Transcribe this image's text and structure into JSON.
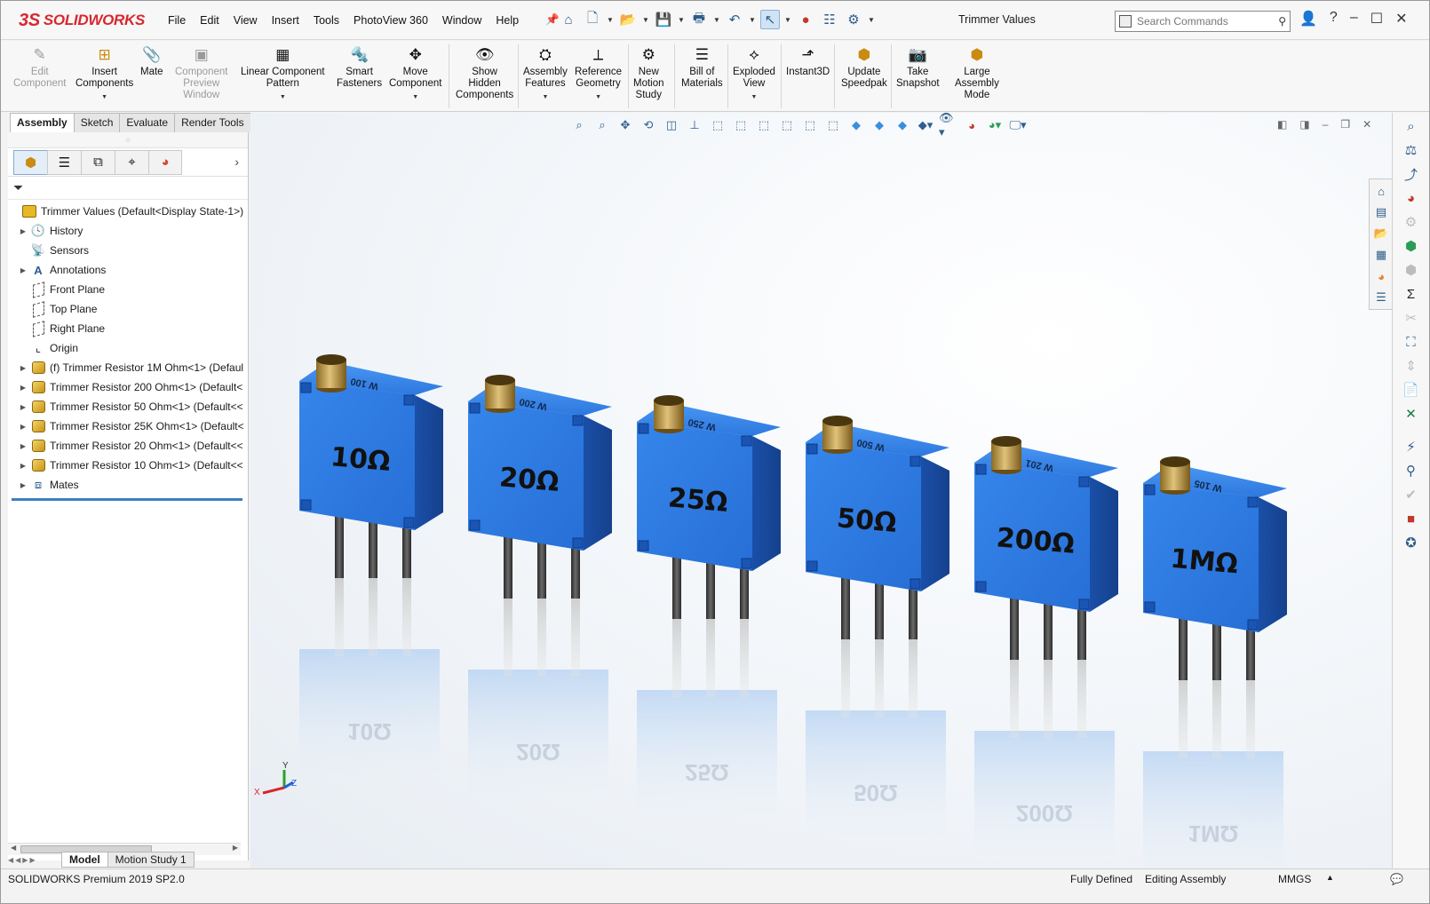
{
  "app": {
    "brand": "SOLIDWORKS",
    "doc_title": "Trimmer Values"
  },
  "menu": [
    "File",
    "Edit",
    "View",
    "Insert",
    "Tools",
    "PhotoView 360",
    "Window",
    "Help"
  ],
  "search": {
    "placeholder": "Search Commands"
  },
  "ribbon": [
    {
      "label": "Edit\nComponent",
      "icon": "edit-component-icon",
      "disabled": true
    },
    {
      "label": "Insert\nComponents",
      "icon": "insert-components-icon",
      "disabled": false
    },
    {
      "label": "Mate",
      "icon": "mate-icon",
      "disabled": false
    },
    {
      "label": "Component\nPreview\nWindow",
      "icon": "preview-window-icon",
      "disabled": true
    },
    {
      "label": "Linear Component\nPattern",
      "icon": "linear-pattern-icon",
      "disabled": false
    },
    {
      "label": "Smart\nFasteners",
      "icon": "smart-fasteners-icon",
      "disabled": false
    },
    {
      "label": "Move\nComponent",
      "icon": "move-component-icon",
      "disabled": false
    },
    {
      "label": "Show\nHidden\nComponents",
      "icon": "show-hidden-icon",
      "disabled": false
    },
    {
      "label": "Assembly\nFeatures",
      "icon": "assembly-features-icon",
      "disabled": false
    },
    {
      "label": "Reference\nGeometry",
      "icon": "reference-geometry-icon",
      "disabled": false
    },
    {
      "label": "New\nMotion\nStudy",
      "icon": "motion-study-icon",
      "disabled": false
    },
    {
      "label": "Bill of\nMaterials",
      "icon": "bom-icon",
      "disabled": false
    },
    {
      "label": "Exploded\nView",
      "icon": "exploded-view-icon",
      "disabled": false
    },
    {
      "label": "Instant3D",
      "icon": "instant3d-icon",
      "disabled": false
    },
    {
      "label": "Update\nSpeedpak",
      "icon": "speedpak-icon",
      "disabled": false
    },
    {
      "label": "Take\nSnapshot",
      "icon": "snapshot-icon",
      "disabled": false
    },
    {
      "label": "Large\nAssembly\nMode",
      "icon": "large-assembly-icon",
      "disabled": false
    }
  ],
  "command_tabs": [
    "Assembly",
    "Sketch",
    "Evaluate",
    "Render Tools"
  ],
  "tree": {
    "root": "Trimmer Values  (Default<Display State-1>)",
    "items": [
      {
        "label": "History",
        "icon": "history-icon",
        "expandable": true
      },
      {
        "label": "Sensors",
        "icon": "sensors-icon",
        "expandable": false
      },
      {
        "label": "Annotations",
        "icon": "annotations-icon",
        "expandable": true
      },
      {
        "label": "Front Plane",
        "icon": "plane-icon",
        "expandable": false
      },
      {
        "label": "Top Plane",
        "icon": "plane-icon",
        "expandable": false
      },
      {
        "label": "Right Plane",
        "icon": "plane-icon",
        "expandable": false
      },
      {
        "label": "Origin",
        "icon": "origin-icon",
        "expandable": false
      },
      {
        "label": "(f) Trimmer Resistor 1M Ohm<1> (Defaul",
        "icon": "part-icon",
        "expandable": true
      },
      {
        "label": "Trimmer Resistor 200 Ohm<1> (Default<",
        "icon": "part-icon",
        "expandable": true
      },
      {
        "label": "Trimmer Resistor 50 Ohm<1> (Default<<",
        "icon": "part-icon",
        "expandable": true
      },
      {
        "label": "Trimmer Resistor 25K Ohm<1> (Default<",
        "icon": "part-icon",
        "expandable": true
      },
      {
        "label": "Trimmer Resistor 20 Ohm<1> (Default<<",
        "icon": "part-icon",
        "expandable": true
      },
      {
        "label": "Trimmer Resistor 10 Ohm<1> (Default<<",
        "icon": "part-icon",
        "expandable": true
      },
      {
        "label": "Mates",
        "icon": "mates-icon",
        "expandable": true
      }
    ]
  },
  "bottom_tabs": [
    "Model",
    "Motion Study 1"
  ],
  "status": {
    "product": "SOLIDWORKS Premium 2019 SP2.0",
    "state": "Fully Defined",
    "mode": "Editing Assembly",
    "units": "MMGS"
  },
  "viewport": {
    "resistors": [
      {
        "value": "10Ω",
        "code": "W 100",
        "body_color": "#2f7ee6"
      },
      {
        "value": "20Ω",
        "code": "W 200",
        "body_color": "#2f7ee6"
      },
      {
        "value": "25Ω",
        "code": "W 250",
        "body_color": "#2f7ee6"
      },
      {
        "value": "50Ω",
        "code": "W 500",
        "body_color": "#2f7ee6"
      },
      {
        "value": "200Ω",
        "code": "W 201",
        "body_color": "#2f7ee6"
      },
      {
        "value": "1MΩ",
        "code": "W 105",
        "body_color": "#2f7ee6"
      }
    ],
    "triad_labels": {
      "x": "X",
      "y": "Y",
      "z": "Z"
    }
  },
  "colors": {
    "accent": "#3d7fc3",
    "brand": "#d7282f",
    "resistor_blue": "#2f7ee6",
    "knob_gold": "#c9a04a"
  }
}
